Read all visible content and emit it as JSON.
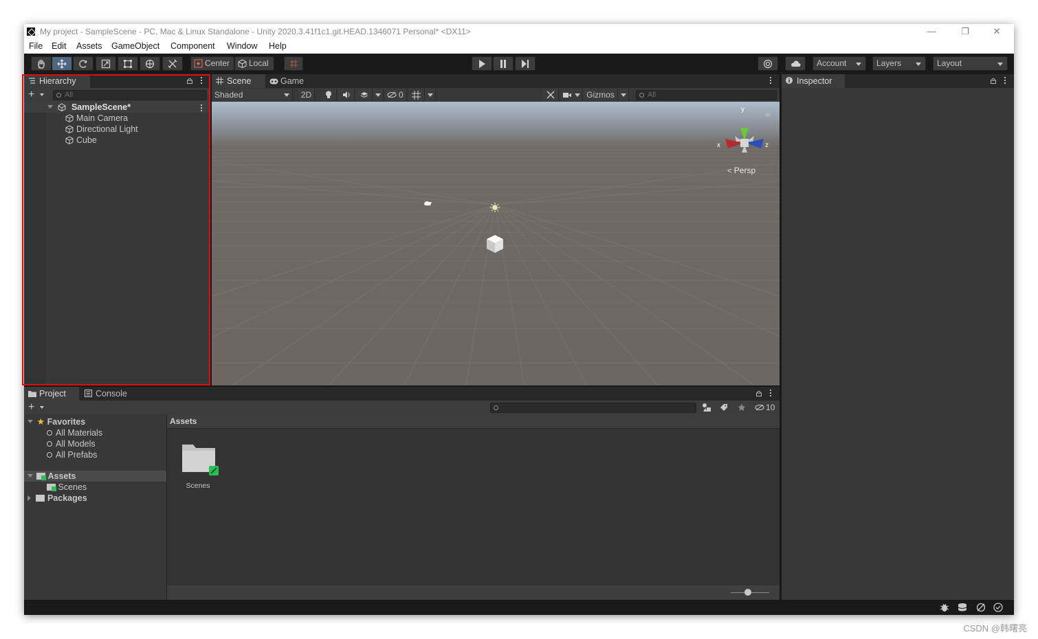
{
  "window": {
    "title": "My project - SampleScene - PC, Mac & Linux Standalone - Unity 2020.3.41f1c1.git.HEAD.1346071 Personal* <DX11>",
    "controls": [
      "—",
      "❐",
      "✕"
    ]
  },
  "menu": [
    "File",
    "Edit",
    "Assets",
    "GameObject",
    "Component",
    "Window",
    "Help"
  ],
  "toolbar": {
    "tools": [
      "hand-tool",
      "move-tool",
      "rotate-tool",
      "scale-tool",
      "rect-tool",
      "transform-tool",
      "custom-tool"
    ],
    "active_tool": "move-tool",
    "pivot_mode": "Center",
    "pivot_rotation": "Local",
    "account_label": "Account",
    "layers_label": "Layers",
    "layout_label": "Layout"
  },
  "hierarchy": {
    "tab_label": "Hierarchy",
    "search_placeholder": "All",
    "scene_name": "SampleScene*",
    "objects": [
      "Main Camera",
      "Directional Light",
      "Cube"
    ]
  },
  "scene_view": {
    "tabs": [
      "Scene",
      "Game"
    ],
    "active_tab": "Scene",
    "shading_mode": "Shaded",
    "mode_2d": "2D",
    "hidden_count": "0",
    "gizmos_label": "Gizmos",
    "search_placeholder": "All",
    "projection_label": "Persp",
    "axis_labels": {
      "x": "x",
      "y": "y",
      "z": "z"
    }
  },
  "inspector": {
    "tab_label": "Inspector"
  },
  "project": {
    "tabs": [
      "Project",
      "Console"
    ],
    "active_tab": "Project",
    "favorites_label": "Favorites",
    "favorites": [
      "All Materials",
      "All Models",
      "All Prefabs"
    ],
    "assets_label": "Assets",
    "asset_children": [
      "Scenes"
    ],
    "packages_label": "Packages",
    "breadcrumb": "Assets",
    "grid_items": [
      "Scenes"
    ],
    "hidden_packages_count": "10",
    "zoom_slider_value": 0.45
  },
  "watermark": "CSDN @韩曙亮",
  "colors": {
    "highlight_border": "#e00f0f",
    "active_tool": "#4d6682",
    "panel_bg": "#383838",
    "toolbar_bg": "#191919"
  }
}
